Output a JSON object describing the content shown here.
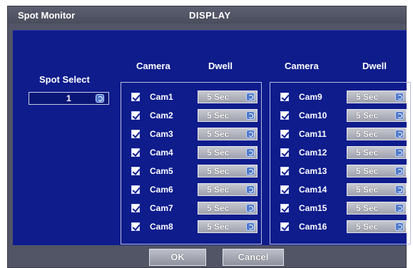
{
  "window": {
    "title": "Spot Monitor",
    "center_title": "DISPLAY"
  },
  "spot": {
    "label": "Spot Select",
    "value": "1"
  },
  "headers": {
    "camera": "Camera",
    "dwell": "Dwell"
  },
  "cameras_left": [
    {
      "name": "Cam1",
      "checked": true,
      "dwell": "5 Sec"
    },
    {
      "name": "Cam2",
      "checked": true,
      "dwell": "5 Sec"
    },
    {
      "name": "Cam3",
      "checked": true,
      "dwell": "5 Sec"
    },
    {
      "name": "Cam4",
      "checked": true,
      "dwell": "5 Sec"
    },
    {
      "name": "Cam5",
      "checked": true,
      "dwell": "5 Sec"
    },
    {
      "name": "Cam6",
      "checked": true,
      "dwell": "5 Sec"
    },
    {
      "name": "Cam7",
      "checked": true,
      "dwell": "5 Sec"
    },
    {
      "name": "Cam8",
      "checked": true,
      "dwell": "5 Sec"
    }
  ],
  "cameras_right": [
    {
      "name": "Cam9",
      "checked": true,
      "dwell": "5 Sec"
    },
    {
      "name": "Cam10",
      "checked": true,
      "dwell": "5 Sec"
    },
    {
      "name": "Cam11",
      "checked": true,
      "dwell": "5 Sec"
    },
    {
      "name": "Cam12",
      "checked": true,
      "dwell": "5 Sec"
    },
    {
      "name": "Cam13",
      "checked": true,
      "dwell": "5 Sec"
    },
    {
      "name": "Cam14",
      "checked": true,
      "dwell": "5 Sec"
    },
    {
      "name": "Cam15",
      "checked": true,
      "dwell": "5 Sec"
    },
    {
      "name": "Cam16",
      "checked": true,
      "dwell": "5 Sec"
    }
  ],
  "buttons": {
    "ok": "OK",
    "cancel": "Cancel"
  },
  "colors": {
    "panel": "#0e1c8c",
    "frame": "#525566",
    "button": "#a8abb6"
  }
}
